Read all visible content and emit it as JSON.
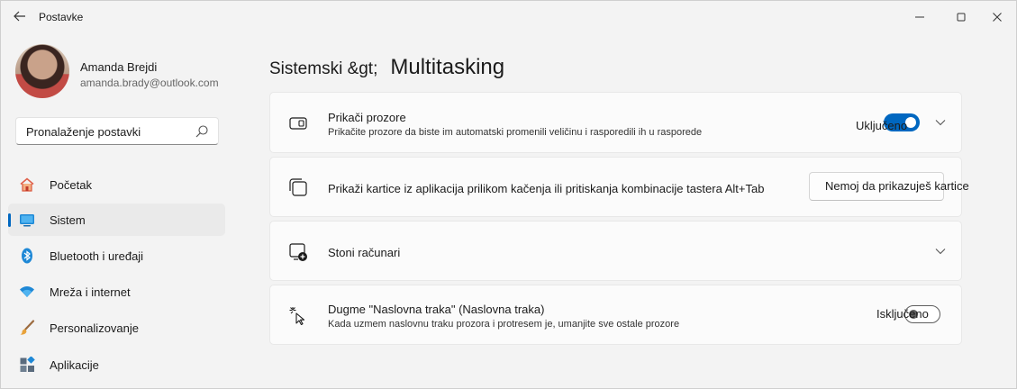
{
  "window": {
    "title": "Postavke",
    "back_icon": "arrow-left-icon",
    "minimize_icon": "minimize-icon",
    "maximize_icon": "maximize-icon",
    "close_icon": "close-icon"
  },
  "profile": {
    "name": "Amanda Brejdi",
    "email": "amanda.brady@outlook.com"
  },
  "search": {
    "placeholder": "Pronalaženje postavki",
    "icon": "search-icon"
  },
  "sidebar": {
    "items": [
      {
        "label": "Početak",
        "icon": "home-icon",
        "active": false
      },
      {
        "label": "Sistem",
        "icon": "system-icon",
        "active": true
      },
      {
        "label": "Bluetooth i uređaji",
        "icon": "bluetooth-icon",
        "active": false
      },
      {
        "label": "Mreža i internet",
        "icon": "wifi-icon",
        "active": false
      },
      {
        "label": "Personalizovanje",
        "icon": "brush-icon",
        "active": false
      },
      {
        "label": "Aplikacije",
        "icon": "apps-icon",
        "active": false
      }
    ]
  },
  "main": {
    "breadcrumb_parent": "Sistemski &gt;",
    "breadcrumb_current": "Multitasking",
    "cards": [
      {
        "title": "Prikači prozore",
        "description": "Prikačite prozore da biste im automatski promenili veličinu i rasporedili ih u rasporede",
        "icon": "snap-window-icon",
        "toggle_label": "Uključeno",
        "toggle_on": true,
        "expandable": true
      },
      {
        "title": "Prikaži kartice iz aplikacija prilikom kačenja ili pritiskanja kombinacije tastera Alt+Tab",
        "icon": "tabs-icon",
        "button_label": "Nemoj da prikazuješ kartice"
      },
      {
        "title": "Stoni računari",
        "icon": "virtual-desktops-icon",
        "expandable": true
      },
      {
        "title": "Dugme \"Naslovna traka\" (Naslovna traka)",
        "description": "Kada uzmem naslovnu traku prozora i protresem je, umanjite sve ostale prozore",
        "icon": "title-bar-shake-icon",
        "toggle_label": "Isključeno",
        "toggle_on": false
      }
    ]
  },
  "colors": {
    "accent": "#0067c0",
    "background": "#f3f3f3",
    "card": "#fbfbfb"
  }
}
